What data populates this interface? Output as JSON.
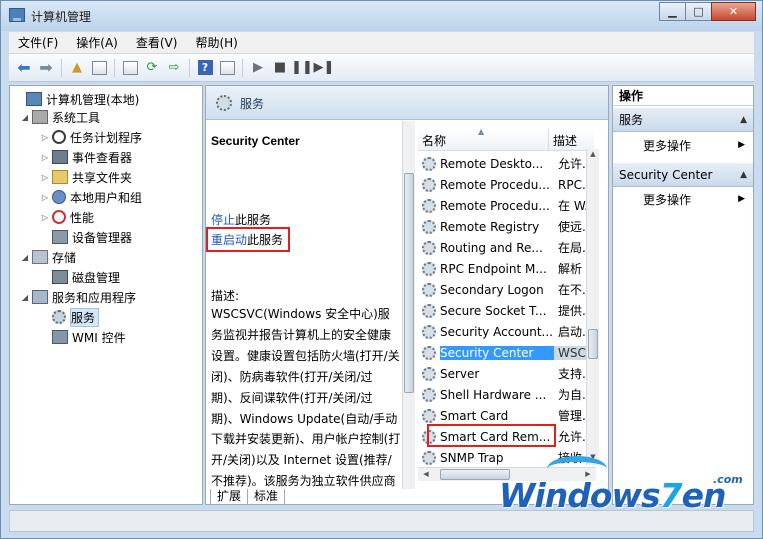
{
  "window": {
    "title": "计算机管理"
  },
  "menu": [
    "文件(F)",
    "操作(A)",
    "查看(V)",
    "帮助(H)"
  ],
  "tree": [
    {
      "label": "计算机管理(本地)",
      "icon": "computer-icon"
    },
    {
      "label": "系统工具",
      "icon": "tools-icon"
    },
    {
      "label": "任务计划程序",
      "icon": "clock-icon"
    },
    {
      "label": "事件查看器",
      "icon": "event-viewer-icon"
    },
    {
      "label": "共享文件夹",
      "icon": "folder-icon"
    },
    {
      "label": "本地用户和组",
      "icon": "users-icon"
    },
    {
      "label": "性能",
      "icon": "performance-icon"
    },
    {
      "label": "设备管理器",
      "icon": "device-manager-icon"
    },
    {
      "label": "存储",
      "icon": "storage-icon"
    },
    {
      "label": "磁盘管理",
      "icon": "disk-icon"
    },
    {
      "label": "服务和应用程序",
      "icon": "services-apps-icon"
    },
    {
      "label": "服务",
      "icon": "gear-icon"
    },
    {
      "label": "WMI 控件",
      "icon": "wmi-icon"
    }
  ],
  "middle": {
    "header": "服务",
    "service_title": "Security Center",
    "stop_link": "停止",
    "stop_suffix": "此服务",
    "restart_link": "重启动",
    "restart_suffix": "此服务",
    "desc_label": "描述:",
    "desc_text": "WSCSVC(Windows 安全中心)服务监视并报告计算机上的安全健康设置。健康设置包括防火墙(打开/关闭)、防病毒软件(打开/关闭/过期)、反间谍软件(打开/关闭/过期)、Windows Update(自动/手动下载并安装更新)、用户帐户控制(打开/关闭)以及 Internet 设置(推荐/不推荐)。该服务为独立软件供应商提供 COM API 以便向安全中心服务注册并记录其产品的状态。操作中心(AC) UI 使用该服务在"
  },
  "list": {
    "columns": [
      "名称",
      "描述"
    ],
    "rows": [
      {
        "name": "Remote Deskto...",
        "desc": "允许..."
      },
      {
        "name": "Remote Procedu...",
        "desc": "RPC..."
      },
      {
        "name": "Remote Procedu...",
        "desc": "在 W..."
      },
      {
        "name": "Remote Registry",
        "desc": "使远..."
      },
      {
        "name": "Routing and Re...",
        "desc": "在局..."
      },
      {
        "name": "RPC Endpoint M...",
        "desc": "解析 ..."
      },
      {
        "name": "Secondary Logon",
        "desc": "在不..."
      },
      {
        "name": "Secure Socket T...",
        "desc": "提供..."
      },
      {
        "name": "Security Account...",
        "desc": "启动..."
      },
      {
        "name": "Security Center",
        "desc": "WSC...",
        "selected": true
      },
      {
        "name": "Server",
        "desc": "支持..."
      },
      {
        "name": "Shell Hardware ...",
        "desc": "为自..."
      },
      {
        "name": "Smart Card",
        "desc": "管理..."
      },
      {
        "name": "Smart Card Rem...",
        "desc": "允许..."
      },
      {
        "name": "SNMP Trap",
        "desc": "接收..."
      }
    ]
  },
  "tabs": [
    "扩展",
    "标准"
  ],
  "actions": {
    "title": "操作",
    "section1": "服务",
    "section1_item": "更多操作",
    "section2": "Security Center",
    "section2_item": "更多操作"
  },
  "watermark": {
    "text_a": "Windows",
    "text_b": "7",
    "text_c": "en",
    "suffix": ".com"
  }
}
